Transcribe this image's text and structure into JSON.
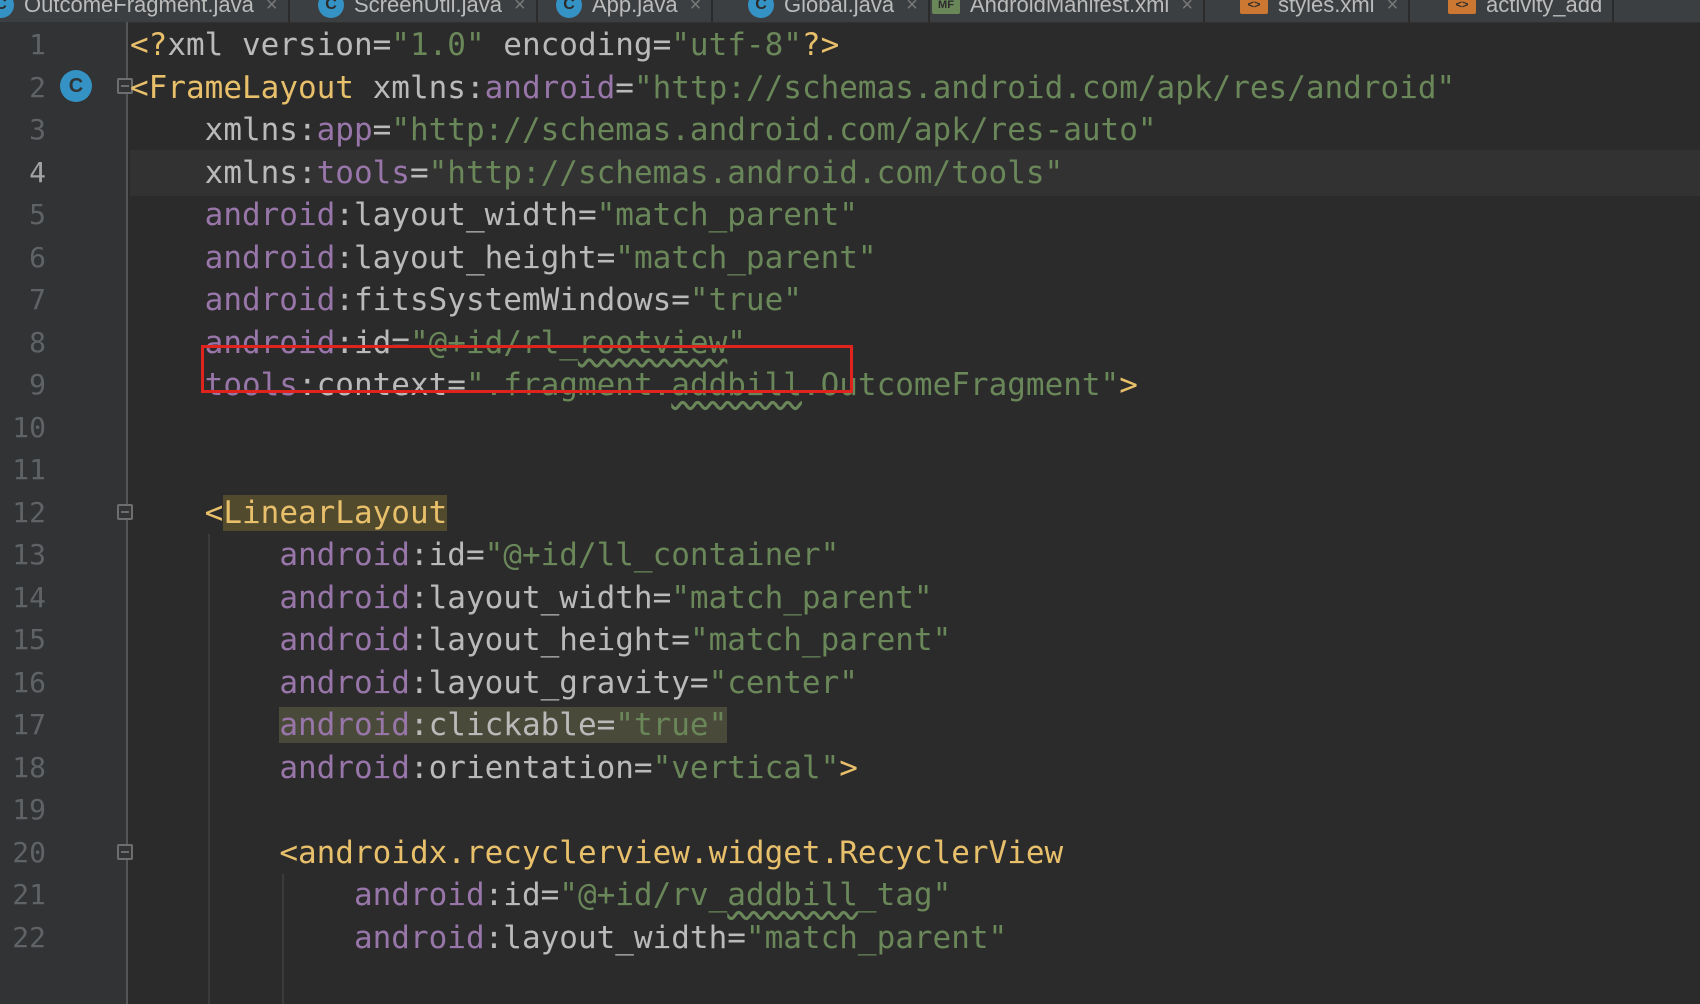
{
  "tabs": [
    {
      "label": "OutcomeFragment.java",
      "icon": "class-icon"
    },
    {
      "label": "ScreenUtil.java",
      "icon": "class-icon"
    },
    {
      "label": "App.java",
      "icon": "class-icon"
    },
    {
      "label": "Global.java",
      "icon": "class-icon"
    },
    {
      "label": "AndroidManifest.xml",
      "icon": "manifest-icon",
      "icon_text": "MF"
    },
    {
      "label": "styles.xml",
      "icon": "xml-icon",
      "icon_text": "<>"
    },
    {
      "label": "activity_add",
      "icon": "xml-icon",
      "icon_text": "<>"
    }
  ],
  "gutter": {
    "line_numbers": [
      "1",
      "2",
      "3",
      "4",
      "5",
      "6",
      "7",
      "8",
      "9",
      "10",
      "11",
      "12",
      "13",
      "14",
      "15",
      "16",
      "17",
      "18",
      "19",
      "20",
      "21",
      "22"
    ],
    "current_line": "4",
    "class_badge": "C"
  },
  "code_lines": [
    [
      [
        "punc",
        "<?"
      ],
      [
        "plain",
        "xml version="
      ],
      [
        "val",
        "\"1.0\""
      ],
      [
        "plain",
        " encoding="
      ],
      [
        "val",
        "\"utf-8\""
      ],
      [
        "punc",
        "?>"
      ]
    ],
    [
      [
        "punc",
        "<"
      ],
      [
        "tag",
        "FrameLayout"
      ],
      [
        "plain",
        " xmlns:"
      ],
      [
        "ns",
        "android"
      ],
      [
        "plain",
        "="
      ],
      [
        "val",
        "\"http://schemas.android.com/apk/res/android\""
      ]
    ],
    [
      [
        "plain",
        "    xmlns:"
      ],
      [
        "ns",
        "app"
      ],
      [
        "plain",
        "="
      ],
      [
        "val",
        "\"http://schemas.android.com/apk/res-auto\""
      ]
    ],
    [
      [
        "plain",
        "    xmlns:"
      ],
      [
        "ns",
        "tools"
      ],
      [
        "plain",
        "="
      ],
      [
        "val",
        "\"http://schemas.android.com/tools\""
      ]
    ],
    [
      [
        "plain",
        "    "
      ],
      [
        "ns",
        "android"
      ],
      [
        "plain",
        ":layout_width="
      ],
      [
        "val",
        "\"match_parent\""
      ]
    ],
    [
      [
        "plain",
        "    "
      ],
      [
        "ns",
        "android"
      ],
      [
        "plain",
        ":layout_height="
      ],
      [
        "val",
        "\"match_parent\""
      ]
    ],
    [
      [
        "plain",
        "    "
      ],
      [
        "ns",
        "android"
      ],
      [
        "plain",
        ":fitsSystemWindows="
      ],
      [
        "val",
        "\"true\""
      ]
    ],
    [
      [
        "plain",
        "    "
      ],
      [
        "ns",
        "android"
      ],
      [
        "plain",
        ":id="
      ],
      [
        "val",
        "\"@+id/rl_"
      ],
      [
        "valsq",
        "rootview"
      ],
      [
        "val",
        "\""
      ]
    ],
    [
      [
        "plain",
        "    "
      ],
      [
        "ns",
        "tools"
      ],
      [
        "plain",
        ":context="
      ],
      [
        "val",
        "\".fragment."
      ],
      [
        "valsq",
        "addbill"
      ],
      [
        "val",
        ".OutcomeFragment\""
      ],
      [
        "punc",
        ">"
      ]
    ],
    [],
    [],
    [
      [
        "plain",
        "    "
      ],
      [
        "punc",
        "<"
      ],
      [
        "taghl",
        "LinearLayout"
      ]
    ],
    [
      [
        "plain",
        "        "
      ],
      [
        "ns",
        "android"
      ],
      [
        "plain",
        ":id="
      ],
      [
        "val",
        "\"@+id/ll_container\""
      ]
    ],
    [
      [
        "plain",
        "        "
      ],
      [
        "ns",
        "android"
      ],
      [
        "plain",
        ":layout_width="
      ],
      [
        "val",
        "\"match_parent\""
      ]
    ],
    [
      [
        "plain",
        "        "
      ],
      [
        "ns",
        "android"
      ],
      [
        "plain",
        ":layout_height="
      ],
      [
        "val",
        "\"match_parent\""
      ]
    ],
    [
      [
        "plain",
        "        "
      ],
      [
        "ns",
        "android"
      ],
      [
        "plain",
        ":layout_gravity="
      ],
      [
        "val",
        "\"center\""
      ]
    ],
    [
      [
        "plain",
        "        "
      ],
      [
        "nshl",
        "android"
      ],
      [
        "plainhl",
        ":clickable="
      ],
      [
        "valhl",
        "\"true\""
      ]
    ],
    [
      [
        "plain",
        "        "
      ],
      [
        "ns",
        "android"
      ],
      [
        "plain",
        ":orientation="
      ],
      [
        "val",
        "\"vertical\""
      ],
      [
        "punc",
        ">"
      ]
    ],
    [],
    [
      [
        "plain",
        "        "
      ],
      [
        "punc",
        "<"
      ],
      [
        "tag",
        "androidx.recyclerview.widget.RecyclerView"
      ]
    ],
    [
      [
        "plain",
        "            "
      ],
      [
        "ns",
        "android"
      ],
      [
        "plain",
        ":id="
      ],
      [
        "val",
        "\"@+id/rv_"
      ],
      [
        "valsq",
        "addbill"
      ],
      [
        "val",
        "_tag\""
      ]
    ],
    [
      [
        "plain",
        "            "
      ],
      [
        "ns",
        "android"
      ],
      [
        "plain",
        ":layout_width="
      ],
      [
        "val",
        "\"match_parent\""
      ]
    ]
  ],
  "colors": {
    "background": "#2b2b2b",
    "gutter": "#313335",
    "tag": "#e8bf6a",
    "namespace": "#9876aa",
    "value": "#6a8759",
    "attribute": "#bababa",
    "highlight_box": "#e0231d"
  }
}
